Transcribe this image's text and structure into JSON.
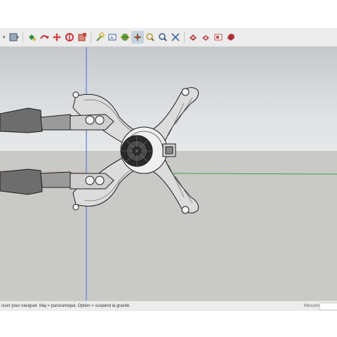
{
  "toolbar": {
    "tools": [
      {
        "name": "select-arrow-icon",
        "color": "#b64a3a"
      },
      {
        "name": "eraser-icon",
        "color": "#9a9a9a"
      },
      {
        "name": "paint-bucket-icon",
        "color": "#2f8c3f"
      },
      {
        "name": "rotate-icon",
        "color": "#c2353a"
      },
      {
        "name": "move-icon",
        "color": "#d23a3a"
      },
      {
        "name": "push-pull-icon",
        "color": "#c9333a"
      },
      {
        "name": "scale-icon",
        "color": "#c4483a"
      },
      {
        "name": "tape-measure-icon",
        "color": "#4f8f3a"
      },
      {
        "name": "text-icon",
        "color": "#3c5f9a"
      },
      {
        "name": "orbit-icon",
        "color": "#3a8a3c"
      },
      {
        "name": "pan-icon",
        "color": "#7a6a3a"
      },
      {
        "name": "zoom-icon",
        "color": "#b49a3a"
      },
      {
        "name": "zoom-window-icon",
        "color": "#3a5a8a"
      },
      {
        "name": "zoom-extents-icon",
        "color": "#3f6aa5"
      },
      {
        "name": "warehouse-icon",
        "color": "#b23a3a"
      },
      {
        "name": "extension-warehouse-icon",
        "color": "#b8474f"
      },
      {
        "name": "layout-icon",
        "color": "#c04a4a"
      },
      {
        "name": "ruby-icon",
        "color": "#b0303a"
      }
    ]
  },
  "status": {
    "hint": "isser pour naviguer. Maj = panoramique, Option =  suspend la gravité.",
    "measurements_label": "Mesures",
    "measurements_value": ""
  },
  "colors": {
    "sky": "#d9dcde",
    "ground": "#c9c9c6",
    "axis_blue": "#4a6bd6",
    "axis_green": "#3aa24a"
  }
}
